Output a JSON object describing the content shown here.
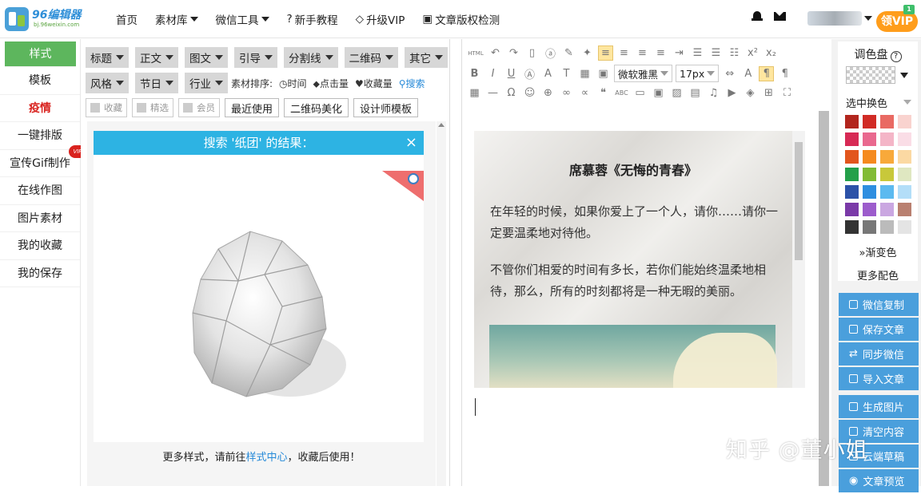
{
  "brand": {
    "name": "96编辑器",
    "url": "bj.96weixin.com"
  },
  "nav": [
    {
      "label": "首页",
      "icon": "",
      "dropdown": false
    },
    {
      "label": "素材库",
      "icon": "",
      "dropdown": true
    },
    {
      "label": "微信工具",
      "icon": "",
      "dropdown": true
    },
    {
      "label": "新手教程",
      "icon": "question-circle-icon",
      "dropdown": false
    },
    {
      "label": "升级VIP",
      "icon": "diamond-icon",
      "dropdown": false
    },
    {
      "label": "文章版权检测",
      "icon": "calendar-check-icon",
      "dropdown": false
    }
  ],
  "header_right": {
    "vip_label": "领VIP",
    "corner": "1"
  },
  "sidebar": [
    {
      "label": "样式"
    },
    {
      "label": "模板"
    },
    {
      "label": "疫情"
    },
    {
      "label": "一键排版"
    },
    {
      "label": "宣传Gif制作"
    },
    {
      "label": "在线作图"
    },
    {
      "label": "图片素材"
    },
    {
      "label": "我的收藏"
    },
    {
      "label": "我的保存"
    }
  ],
  "sidebar_badge": "VIP",
  "filters_row1": [
    "标题",
    "正文",
    "图文",
    "引导",
    "分割线",
    "二维码",
    "其它"
  ],
  "filters_row2": [
    "风格",
    "节日",
    "行业"
  ],
  "sort": {
    "label": "素材排序:",
    "options": [
      "时间",
      "点击量",
      "收藏量"
    ],
    "search": "搜索"
  },
  "checkboxes": [
    "收藏",
    "精选",
    "会员"
  ],
  "buttons": [
    "最近使用",
    "二维码美化",
    "设计师模板"
  ],
  "search_result": {
    "title": "搜索 '纸团' 的结果：",
    "close": "×"
  },
  "more_tip": {
    "before": "更多样式，请前往",
    "link": "样式中心",
    "after": "，收藏后使用！"
  },
  "editor": {
    "html_label": "HTML",
    "font": "微软雅黑",
    "size": "17px",
    "doc_title": "席慕蓉《无悔的青春》",
    "p1": "在年轻的时候，如果你爱上了一个人，请你……请你一定要温柔地对待他。",
    "p2": "不管你们相爱的时间有多长，若你们能始终温柔地相待，那么，所有的时刻都将是一种无暇的美丽。"
  },
  "palette": {
    "title": "调色盘",
    "help": "?",
    "select_label": "选中换色",
    "gradient": "渐变色",
    "more": "更多配色",
    "colors": [
      "#b2261e",
      "#d12b25",
      "#e96a63",
      "#f9d3cf",
      "#d72a55",
      "#e9688e",
      "#f4b5c7",
      "#fadde6",
      "#e2561d",
      "#f58a1e",
      "#f8a93a",
      "#fbd9a3",
      "#24a04a",
      "#82bb35",
      "#c8c83a",
      "#dfe7c1",
      "#2c52a8",
      "#2e8ee0",
      "#5cbaf0",
      "#b3def8",
      "#7a3aa8",
      "#9c5ccc",
      "#caa7e1",
      "#b98070",
      "#333333",
      "#777777",
      "#bbbbbb",
      "#e4e4e4"
    ]
  },
  "actions": [
    "微信复制",
    "保存文章",
    "同步微信",
    "导入文章",
    "生成图片",
    "清空内容",
    "云端草稿",
    "文章预览"
  ],
  "watermark": "知乎 @董小姐"
}
